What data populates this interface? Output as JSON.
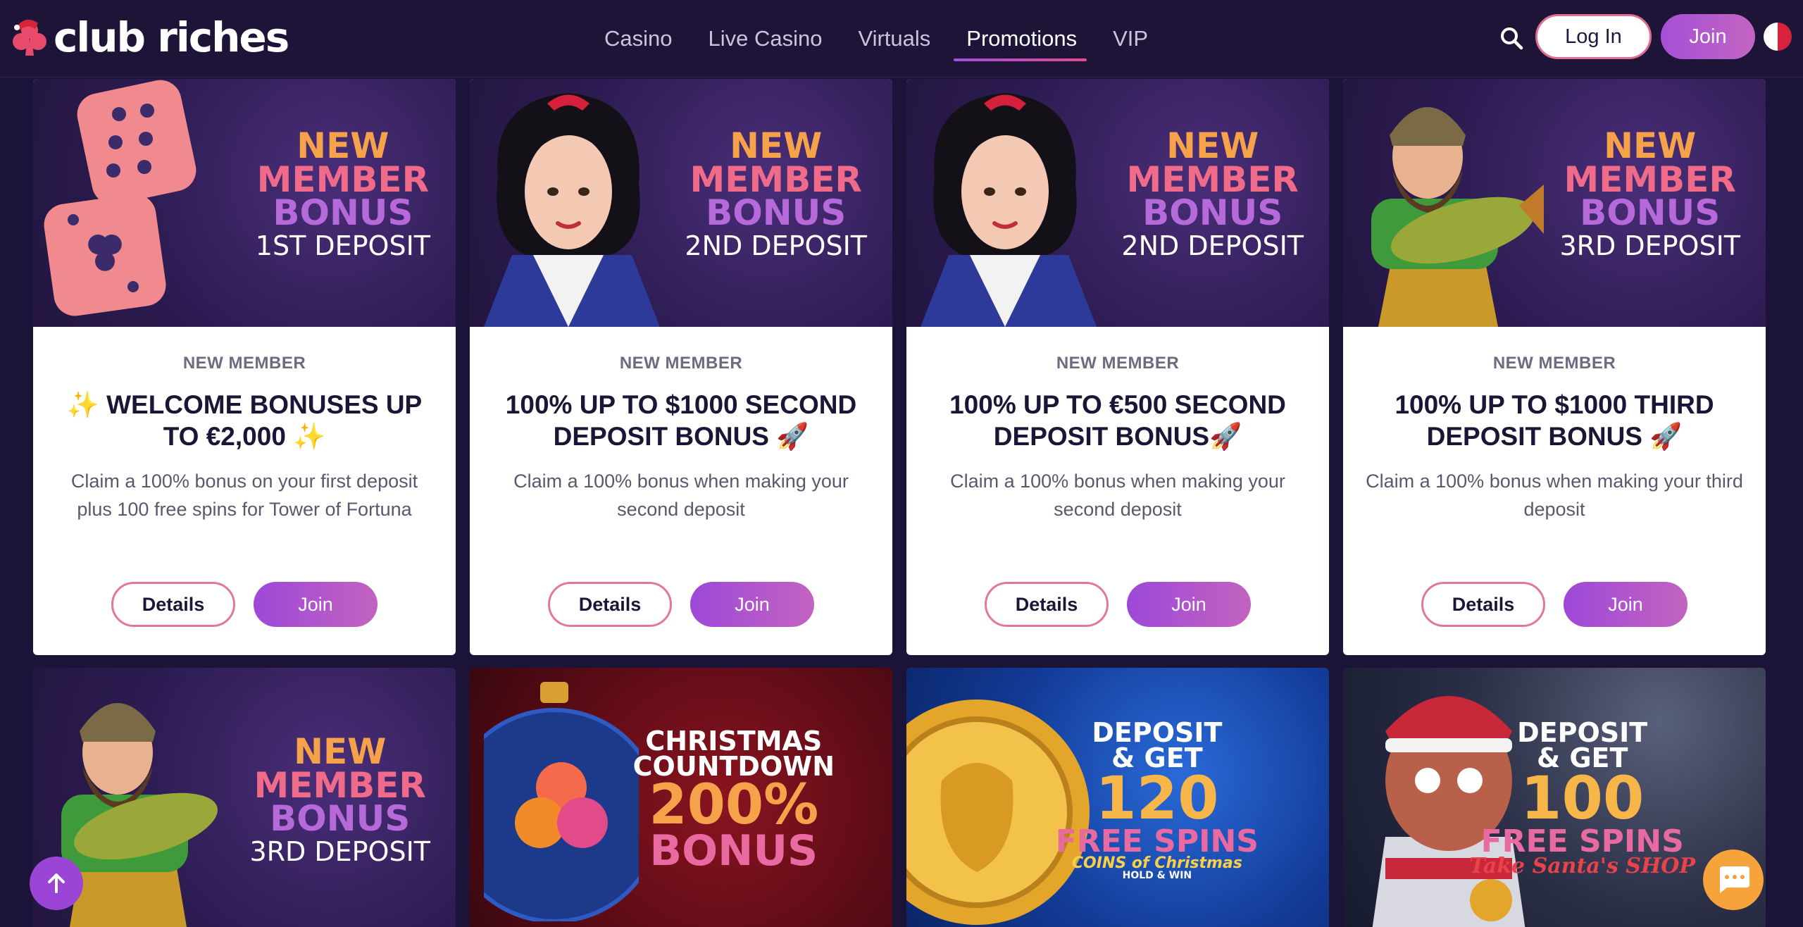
{
  "header": {
    "brand": "club riches",
    "nav": [
      "Casino",
      "Live Casino",
      "Virtuals",
      "Promotions",
      "VIP"
    ],
    "active_nav": "Promotions",
    "login_label": "Log In",
    "join_label": "Join"
  },
  "cards": [
    {
      "banner": {
        "new": "NEW",
        "member": "MEMBER",
        "bonus": "BONUS",
        "deposit": "1ST DEPOSIT"
      },
      "tag": "NEW MEMBER",
      "title": "✨ WELCOME BONUSES UP TO €2,000 ✨",
      "desc": "Claim a 100% bonus on your first deposit plus 100 free spins for Tower of Fortuna",
      "details": "Details",
      "join": "Join"
    },
    {
      "banner": {
        "new": "NEW",
        "member": "MEMBER",
        "bonus": "BONUS",
        "deposit": "2ND DEPOSIT"
      },
      "tag": "NEW MEMBER",
      "title": "100% UP TO $1000 SECOND DEPOSIT BONUS 🚀",
      "desc": "Claim a 100% bonus when making your second deposit",
      "details": "Details",
      "join": "Join"
    },
    {
      "banner": {
        "new": "NEW",
        "member": "MEMBER",
        "bonus": "BONUS",
        "deposit": "2ND DEPOSIT"
      },
      "tag": "NEW MEMBER",
      "title": "100% UP TO €500 SECOND DEPOSIT BONUS🚀",
      "desc": "Claim a 100% bonus when making your second deposit",
      "details": "Details",
      "join": "Join"
    },
    {
      "banner": {
        "new": "NEW",
        "member": "MEMBER",
        "bonus": "BONUS",
        "deposit": "3RD DEPOSIT"
      },
      "tag": "NEW MEMBER",
      "title": "100% UP TO $1000 THIRD DEPOSIT BONUS 🚀",
      "desc": "Claim a 100% bonus when making your third deposit",
      "details": "Details",
      "join": "Join"
    }
  ],
  "bottom_banners": [
    {
      "new": "NEW",
      "member": "MEMBER",
      "bonus": "BONUS",
      "deposit": "3RD DEPOSIT"
    },
    {
      "line1": "CHRISTMAS",
      "line2": "COUNTDOWN",
      "line3": "200%",
      "line4": "BONUS"
    },
    {
      "line1": "DEPOSIT",
      "line2": "& GET",
      "line3": "120",
      "line4": "FREE SPINS",
      "game": "COINS of Christmas",
      "sub": "HOLD & WIN"
    },
    {
      "line1": "DEPOSIT",
      "line2": "& GET",
      "line3": "100",
      "line4": "FREE SPINS",
      "game": "Take Santa's SHOP"
    }
  ],
  "colors": {
    "bg": "#1c1338",
    "accent_purple": "#9d48d8",
    "accent_pink": "#e07a93",
    "orange": "#f6a24a"
  },
  "icons": [
    "search-icon",
    "arrow-up-icon",
    "chat-icon",
    "flag-icon",
    "logo-club-icon"
  ]
}
